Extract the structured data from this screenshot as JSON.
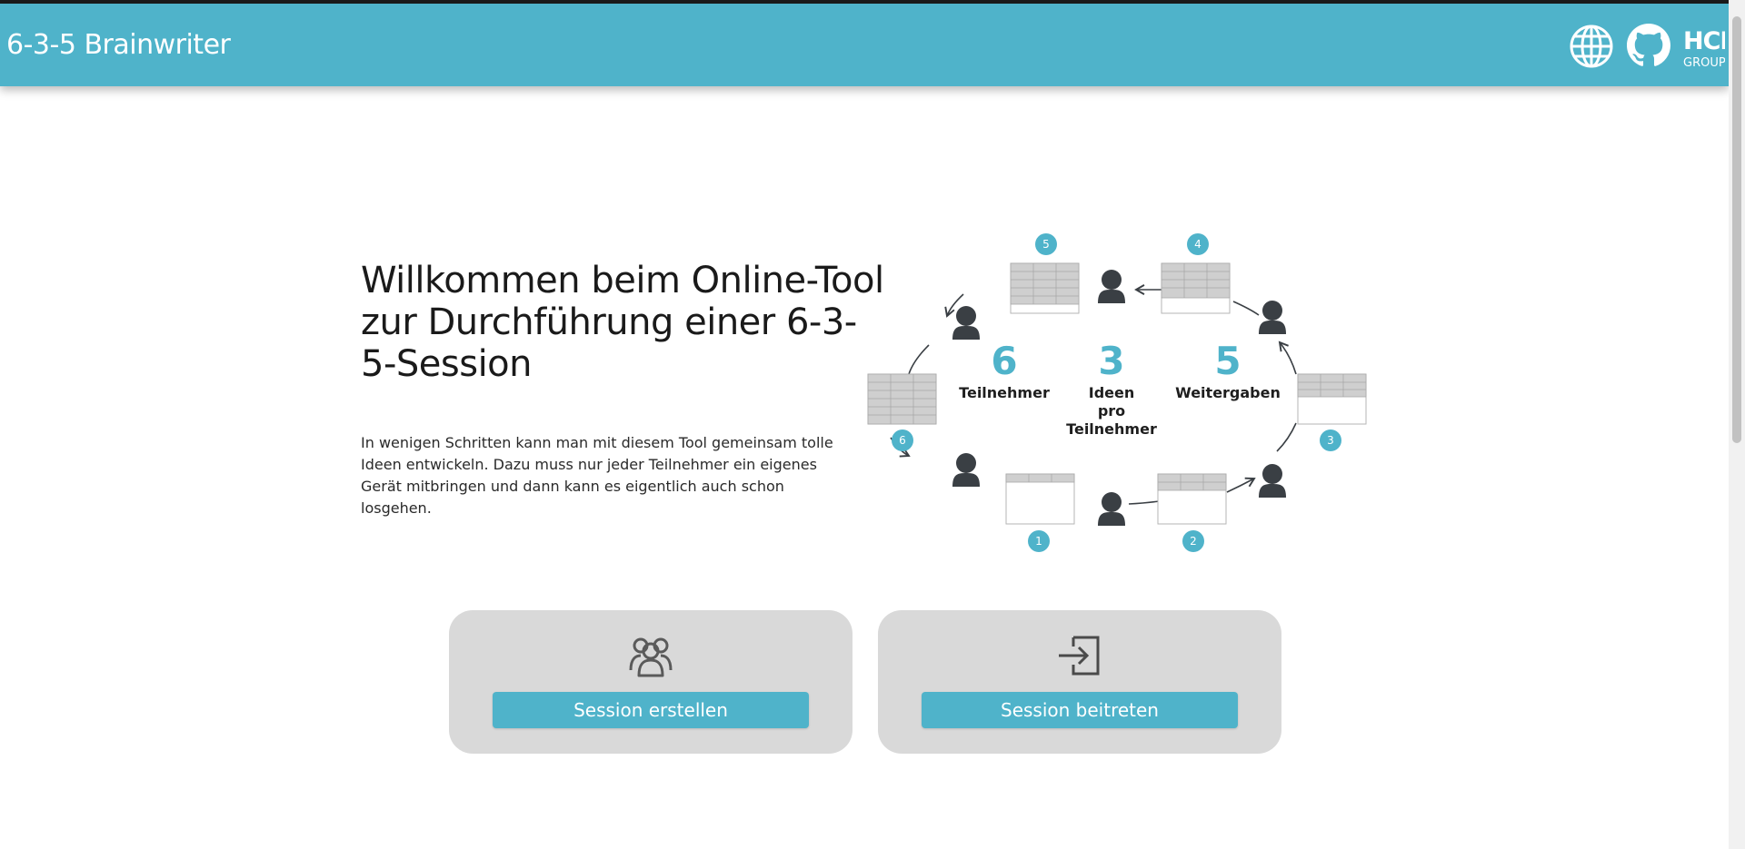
{
  "header": {
    "brand": "6-3-5 Brainwriter",
    "icons": [
      "globe-icon",
      "github-icon",
      "hci-group-logo"
    ],
    "logo_text": [
      "HCI",
      "GROUP"
    ],
    "background_color": "#4fb3ca"
  },
  "hero": {
    "title": "Willkommen beim Online-Tool zur Durchführung einer 6-3-5-Session",
    "intro": "In wenigen Schritten kann man mit diesem Tool gemeinsam tolle Ideen entwickeln. Dazu muss nur jeder Teilnehmer ein eigenes Gerät mitbringen und dann kann es eigentlich auch schon losgehen."
  },
  "diagram": {
    "stats": [
      {
        "number": "6",
        "label": "Teilnehmer"
      },
      {
        "number": "3",
        "label_lines": [
          "Ideen",
          "pro",
          "Teilnehmer"
        ]
      },
      {
        "number": "5",
        "label": "Weitergaben"
      }
    ],
    "step_numbers": [
      "1",
      "2",
      "3",
      "4",
      "5",
      "6"
    ],
    "accent_color": "#4fb3ca",
    "person_color": "#3a3f44"
  },
  "actions": {
    "create": {
      "label": "Session erstellen",
      "icon": "group-icon"
    },
    "join": {
      "label": "Session beitreten",
      "icon": "sign-in-icon"
    }
  }
}
